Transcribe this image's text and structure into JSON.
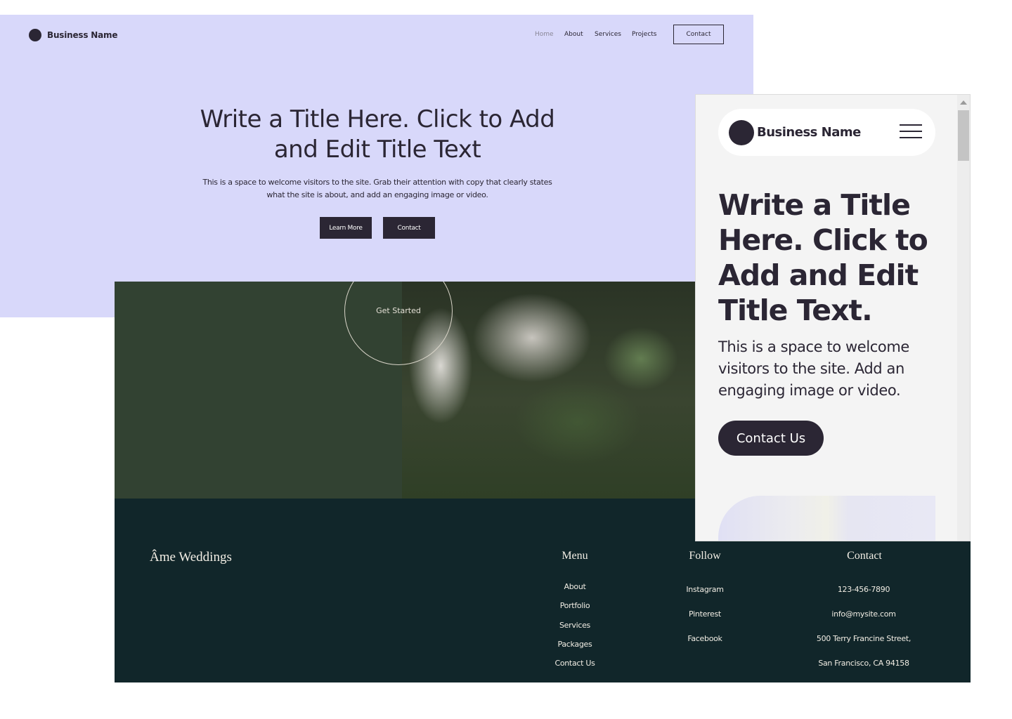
{
  "desktop": {
    "brand": "Business Name",
    "nav": [
      "Home",
      "About",
      "Services",
      "Projects"
    ],
    "contact_button": "Contact",
    "title": "Write a Title Here. Click to Add and Edit Title Text",
    "body": "This is a space to welcome visitors to the site. Grab their attention with copy that clearly states what the site is about, and add an engaging image or video.",
    "learn_more": "Learn More",
    "contact": "Contact",
    "colors": {
      "background": "#d8d8fa",
      "accent": "#2b2634"
    }
  },
  "wedding": {
    "get_started": "Get Started",
    "brand": "Âme Weddings",
    "menu": {
      "heading": "Menu",
      "items": [
        "About",
        "Portfolio",
        "Services",
        "Packages",
        "Contact Us"
      ]
    },
    "follow": {
      "heading": "Follow",
      "items": [
        "Instagram",
        "Pinterest",
        "Facebook"
      ]
    },
    "contact": {
      "heading": "Contact",
      "items": [
        "123-456-7890",
        "info@mysite.com",
        "500 Terry Francine Street,",
        "San Francisco, CA 94158"
      ]
    },
    "colors": {
      "green_panel": "#324232",
      "footer": "#11262a"
    }
  },
  "mobile": {
    "brand": "Business Name",
    "title": "Write a Title Here. Click to Add and Edit Title Text.",
    "body": "This is a space to welcome visitors to the site. Add an engaging image or video.",
    "cta": "Contact Us",
    "icons": {
      "menu": "hamburger-menu-icon",
      "scroll": "scroll-up-arrow-icon"
    }
  }
}
